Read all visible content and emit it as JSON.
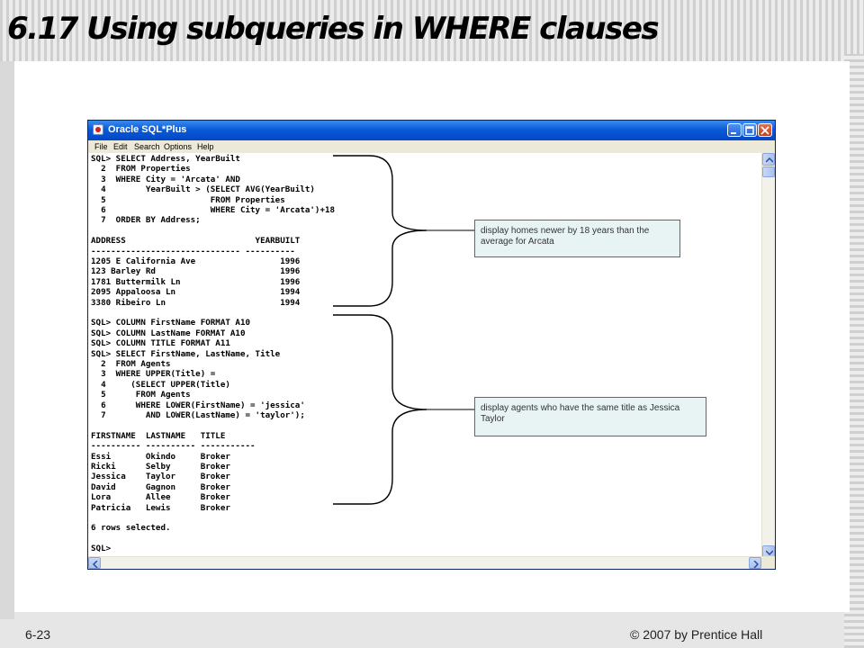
{
  "slide": {
    "title": "6.17 Using subqueries in WHERE clauses",
    "footer_left": "6-23",
    "footer_right": "© 2007 by Prentice Hall"
  },
  "window": {
    "title": "Oracle SQL*Plus",
    "menu": [
      "File",
      "Edit",
      "Search",
      "Options",
      "Help"
    ]
  },
  "console_lines": [
    "SQL> SELECT Address, YearBuilt",
    "  2  FROM Properties",
    "  3  WHERE City = 'Arcata' AND",
    "  4        YearBuilt > (SELECT AVG(YearBuilt)",
    "  5                     FROM Properties",
    "  6                     WHERE City = 'Arcata')+18",
    "  7  ORDER BY Address;",
    "",
    "ADDRESS                          YEARBUILT",
    "------------------------------ ----------",
    "1205 E California Ave                 1996",
    "123 Barley Rd                         1996",
    "1781 Buttermilk Ln                    1996",
    "2095 Appaloosa Ln                     1994",
    "3380 Ribeiro Ln                       1994",
    "",
    "SQL> COLUMN FirstName FORMAT A10",
    "SQL> COLUMN LastName FORMAT A10",
    "SQL> COLUMN TITLE FORMAT A11",
    "SQL> SELECT FirstName, LastName, Title",
    "  2  FROM Agents",
    "  3  WHERE UPPER(Title) =",
    "  4     (SELECT UPPER(Title)",
    "  5      FROM Agents",
    "  6      WHERE LOWER(FirstName) = 'jessica'",
    "  7        AND LOWER(LastName) = 'taylor');",
    "",
    "FIRSTNAME  LASTNAME   TITLE",
    "---------- ---------- -----------",
    "Essi       Okindo     Broker",
    "Ricki      Selby      Broker",
    "Jessica    Taylor     Broker",
    "David      Gagnon     Broker",
    "Lora       Allee      Broker",
    "Patricia   Lewis      Broker",
    "",
    "6 rows selected.",
    "",
    "SQL>"
  ],
  "callouts": {
    "first": "display homes newer by 18 years than the average for Arcata",
    "second": "display agents who have the same title as Jessica Taylor"
  }
}
